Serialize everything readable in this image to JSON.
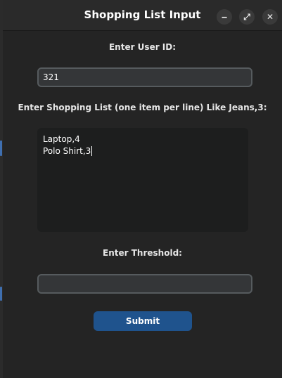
{
  "window": {
    "title": "Shopping List Input",
    "controls": {
      "minimize": "‒",
      "maximize": "⤢",
      "close": "✕"
    }
  },
  "form": {
    "user_id_label": "Enter User ID:",
    "user_id_value": "321",
    "shopping_list_label": "Enter Shopping List (one item per line) Like Jeans,3:",
    "shopping_list_lines": [
      "Laptop,4",
      "Polo Shirt,3"
    ],
    "threshold_label": "Enter Threshold:",
    "threshold_value": "",
    "submit_label": "Submit"
  },
  "colors": {
    "window_bg": "#242424",
    "entry_bg": "#343638",
    "entry_border": "#565b5e",
    "textbox_bg": "#1d1e1e",
    "button_bg": "#1f538d"
  }
}
